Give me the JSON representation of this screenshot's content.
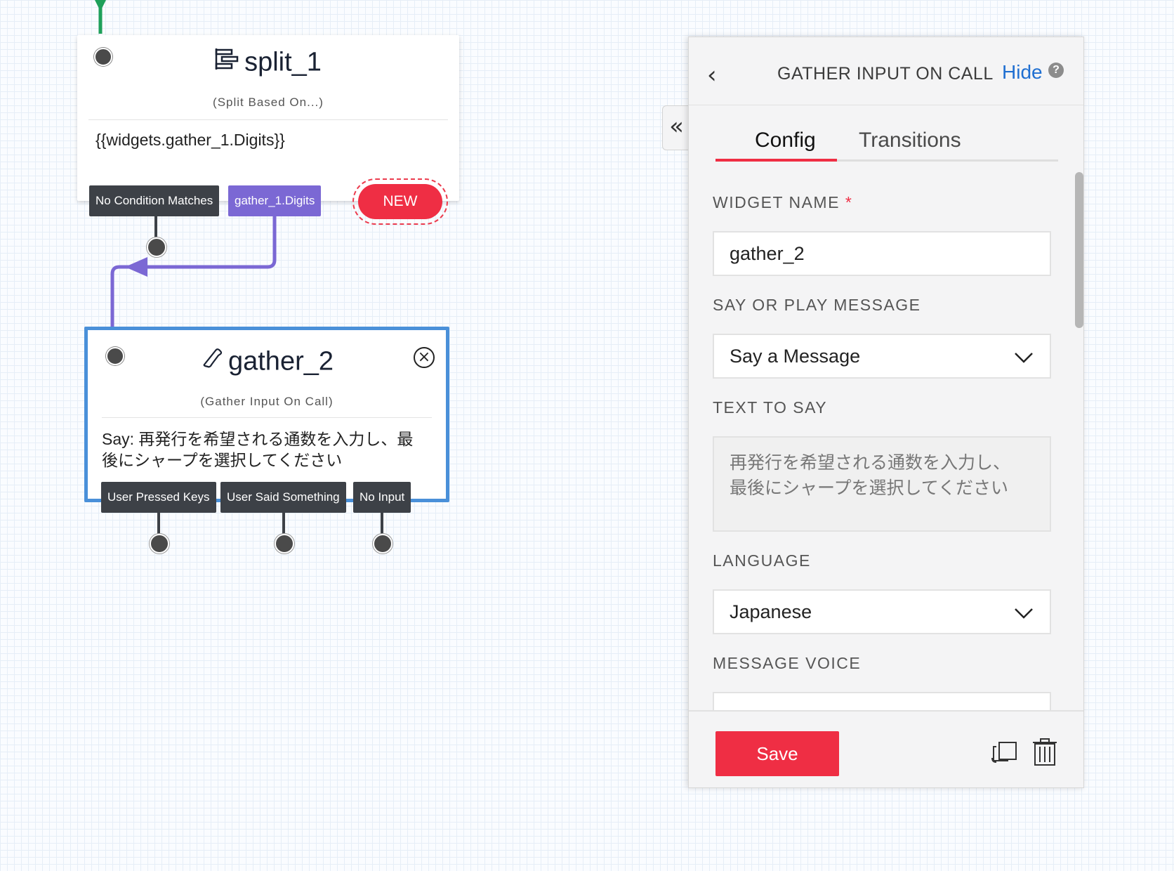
{
  "split_widget": {
    "title": "split_1",
    "subtitle": "(Split Based On...)",
    "body": "{{widgets.gather_1.Digits}}",
    "transitions": [
      "No Condition Matches",
      "gather_1.Digits"
    ],
    "new_label": "NEW"
  },
  "gather_widget": {
    "title": "gather_2",
    "subtitle": "(Gather Input On Call)",
    "body_line1": "Say: 再発行を希望される通数を入力し、最",
    "body_line2": "後にシャープを選択してください",
    "transitions": [
      "User Pressed Keys",
      "User Said Something",
      "No Input"
    ]
  },
  "panel": {
    "title": "GATHER INPUT ON CALL",
    "hide_label": "Hide",
    "help_label": "?",
    "tabs": [
      {
        "label": "Config",
        "active": true
      },
      {
        "label": "Transitions",
        "active": false
      }
    ],
    "fields": {
      "widget_name_label": "WIDGET NAME",
      "widget_name_required": "*",
      "widget_name_value": "gather_2",
      "say_or_play_label": "SAY OR PLAY MESSAGE",
      "say_or_play_value": "Say a Message",
      "text_to_say_label": "TEXT TO SAY",
      "text_to_say_line1": "再発行を希望される通数を入力し、",
      "text_to_say_line2": "最後にシャープを選択してください",
      "language_label": "LANGUAGE",
      "language_value": "Japanese",
      "message_voice_label": "MESSAGE VOICE"
    },
    "save_label": "Save"
  },
  "colors": {
    "accent_red": "#ef2e44",
    "purple": "#7b68d4",
    "selected_blue": "#4a90d9",
    "link_blue": "#1f6fd1",
    "green": "#1ea05a"
  },
  "icons": [
    "split-icon",
    "phone-icon",
    "close-circle-icon",
    "collapse-icon",
    "back-chevron-icon",
    "help-icon",
    "dropdown-chevron-icon",
    "duplicate-icon",
    "trash-icon"
  ]
}
